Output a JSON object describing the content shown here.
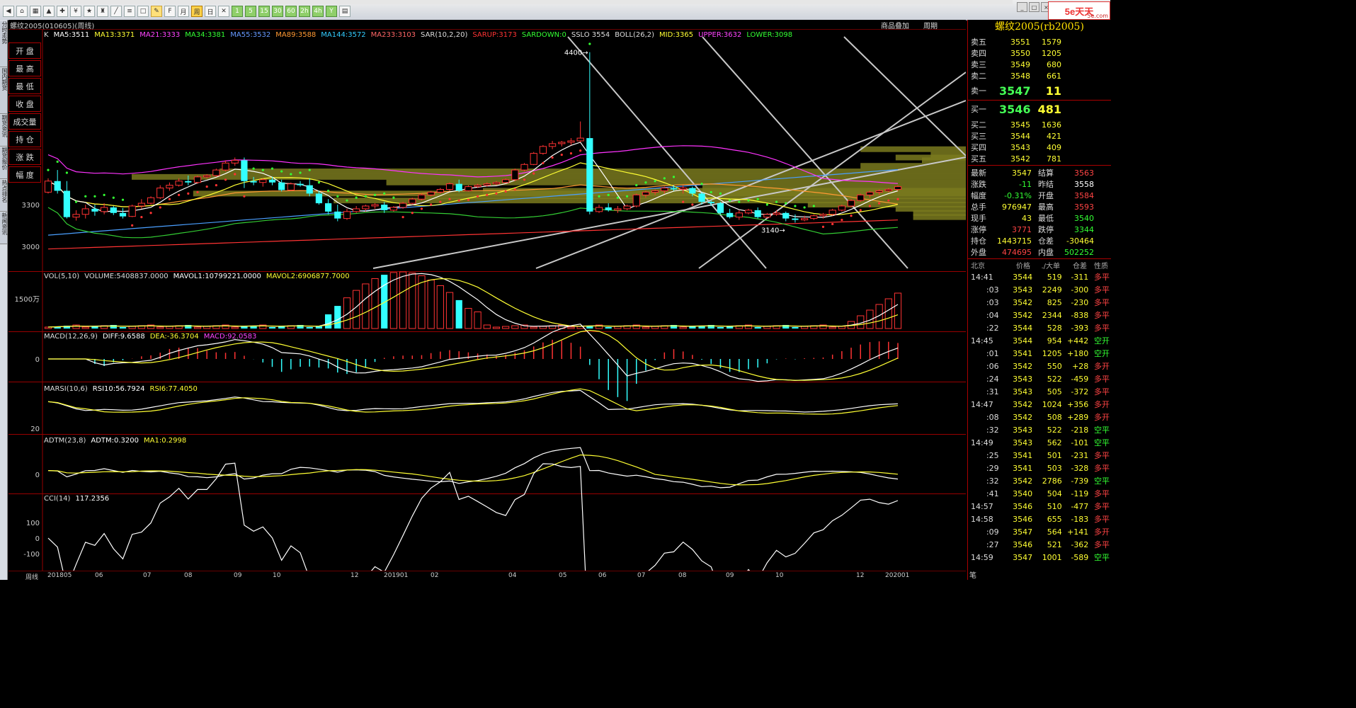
{
  "toolbar": {
    "buttons": [
      {
        "name": "back",
        "g": "◀"
      },
      {
        "name": "home",
        "g": "⌂"
      },
      {
        "name": "grid",
        "g": "▦"
      },
      {
        "name": "chart",
        "g": "▲"
      },
      {
        "name": "alert",
        "g": "✚"
      },
      {
        "name": "cash",
        "g": "¥"
      },
      {
        "name": "fav",
        "g": "★"
      },
      {
        "name": "cup",
        "g": "♜"
      },
      {
        "name": "line",
        "g": "╱"
      },
      {
        "name": "list",
        "g": "≡"
      },
      {
        "name": "box",
        "g": "□"
      },
      {
        "name": "sd",
        "g": "✎"
      },
      {
        "name": "f10",
        "g": "F"
      },
      {
        "name": "mo",
        "g": "月"
      },
      {
        "name": "wk",
        "g": "周"
      },
      {
        "name": "day",
        "g": "日"
      },
      {
        "name": "x",
        "g": "✕"
      },
      {
        "name": "m1",
        "g": "1"
      },
      {
        "name": "m5",
        "g": "5"
      },
      {
        "name": "m15",
        "g": "15"
      },
      {
        "name": "m30",
        "g": "30"
      },
      {
        "name": "m60",
        "g": "60"
      },
      {
        "name": "h2",
        "g": "2h"
      },
      {
        "name": "h4",
        "g": "4h"
      },
      {
        "name": "y",
        "g": "Y"
      },
      {
        "name": "calc",
        "g": "▤"
      }
    ]
  },
  "brand": {
    "mark": "5e天天",
    "sub": "5e.com"
  },
  "left_tabs": [
    "分时走势",
    "国内期货",
    "期货资讯",
    "期货报价",
    "热点排名",
    "新闻资讯"
  ],
  "attr_buttons": [
    "开 盘",
    "最 高",
    "最 低",
    "收 盘",
    "成交量",
    "持 仓",
    "涨 跌",
    "幅 度"
  ],
  "chart": {
    "title": "螺纹2005(010605)(周线)",
    "right_links": [
      "商品叠加",
      "周期"
    ],
    "indicator_line": [
      {
        "t": "K",
        "c": "#dddddd"
      },
      {
        "t": "MA5:3511",
        "c": "#ffffff"
      },
      {
        "t": "MA13:3371",
        "c": "#ffff33"
      },
      {
        "t": "MA21:3333",
        "c": "#ff44ff"
      },
      {
        "t": "MA34:3381",
        "c": "#33ff33"
      },
      {
        "t": "MA55:3532",
        "c": "#6699ff"
      },
      {
        "t": "MA89:3588",
        "c": "#ff9933"
      },
      {
        "t": "MA144:3572",
        "c": "#33ccff"
      },
      {
        "t": "MA233:3103",
        "c": "#ff6666"
      },
      {
        "t": "SAR(10,2,20)",
        "c": "#dddddd"
      },
      {
        "t": "SARUP:3173",
        "c": "#ff3333"
      },
      {
        "t": "SARDOWN:0",
        "c": "#33ff33"
      },
      {
        "t": "SSLO 3554",
        "c": "#dddddd"
      },
      {
        "t": "BOLL(26,2)",
        "c": "#dddddd"
      },
      {
        "t": "MID:3365",
        "c": "#ffff33"
      },
      {
        "t": "UPPER:3632",
        "c": "#ff44ff"
      },
      {
        "t": "LOWER:3098",
        "c": "#33ff33"
      }
    ],
    "y_labels": [
      "3300",
      "3000"
    ],
    "annot_high": "4400",
    "annot_low": "3140",
    "vol_line": [
      {
        "t": "VOL(5,10)",
        "c": "#dddddd"
      },
      {
        "t": "VOLUME:5408837.0000",
        "c": "#dddddd"
      },
      {
        "t": "MAVOL1:10799221.0000",
        "c": "#ffffff"
      },
      {
        "t": "MAVOL2:6906877.7000",
        "c": "#ffff33"
      }
    ],
    "vol_y": "1500万",
    "macd_line": [
      {
        "t": "MACD(12,26,9)",
        "c": "#dddddd"
      },
      {
        "t": "DIFF:9.6588",
        "c": "#ffffff"
      },
      {
        "t": "DEA:-36.3704",
        "c": "#ffff33"
      },
      {
        "t": "MACD:92.0583",
        "c": "#ff44ff"
      }
    ],
    "macd_y": "0",
    "rsi_line": [
      {
        "t": "MARSI(10,6)",
        "c": "#dddddd"
      },
      {
        "t": "RSI10:56.7924",
        "c": "#ffffff"
      },
      {
        "t": "RSI6:77.4050",
        "c": "#ffff33"
      }
    ],
    "rsi_y": "20",
    "adtm_line": [
      {
        "t": "ADTM(23,8)",
        "c": "#dddddd"
      },
      {
        "t": "ADTM:0.3200",
        "c": "#ffffff"
      },
      {
        "t": "MA1:0.2998",
        "c": "#ffff33"
      }
    ],
    "adtm_y": "0",
    "cci_line": [
      {
        "t": "CCI(14)",
        "c": "#dddddd"
      },
      {
        "t": "117.2356",
        "c": "#ffffff"
      }
    ],
    "cci_y": [
      "100",
      "0",
      "-100"
    ],
    "period_label": "周线",
    "date_labels": [
      "201805",
      "06",
      "07",
      "08",
      "09",
      "10",
      "12",
      "201901",
      "02",
      "04",
      "05",
      "06",
      "07",
      "08",
      "09",
      "10",
      "12",
      "202001"
    ]
  },
  "quote": {
    "title": "螺纹2005(rb2005)",
    "asks": [
      {
        "l": "卖五",
        "p": "3551",
        "v": "1579"
      },
      {
        "l": "卖四",
        "p": "3550",
        "v": "1205"
      },
      {
        "l": "卖三",
        "p": "3549",
        "v": "680"
      },
      {
        "l": "卖二",
        "p": "3548",
        "v": "661"
      }
    ],
    "ask1": {
      "l": "卖一",
      "p": "3547",
      "v": "11"
    },
    "bid1": {
      "l": "买一",
      "p": "3546",
      "v": "481"
    },
    "bids": [
      {
        "l": "买二",
        "p": "3545",
        "v": "1636"
      },
      {
        "l": "买三",
        "p": "3544",
        "v": "421"
      },
      {
        "l": "买四",
        "p": "3543",
        "v": "409"
      },
      {
        "l": "买五",
        "p": "3542",
        "v": "781"
      }
    ],
    "stats": [
      {
        "a": "最新",
        "av": "3547",
        "ac": "#ffff33",
        "b": "结算",
        "bv": "3563",
        "bc": "#ff4444"
      },
      {
        "a": "涨跌",
        "av": "-11",
        "ac": "#33ff33",
        "b": "昨结",
        "bv": "3558",
        "bc": "#ffffff"
      },
      {
        "a": "幅度",
        "av": "-0.31%",
        "ac": "#33ff33",
        "b": "开盘",
        "bv": "3584",
        "bc": "#ff4444"
      },
      {
        "a": "总手",
        "av": "976947",
        "ac": "#ffff33",
        "b": "最高",
        "bv": "3593",
        "bc": "#ff4444"
      },
      {
        "a": "现手",
        "av": "43",
        "ac": "#ffff33",
        "b": "最低",
        "bv": "3540",
        "bc": "#33ff33"
      },
      {
        "a": "涨停",
        "av": "3771",
        "ac": "#ff4444",
        "b": "跌停",
        "bv": "3344",
        "bc": "#33ff33"
      },
      {
        "a": "持仓",
        "av": "1443715",
        "ac": "#ffff33",
        "b": "仓差",
        "bv": "-30464",
        "bc": "#ffff33"
      },
      {
        "a": "外盘",
        "av": "474695",
        "ac": "#ff4444",
        "b": "内盘",
        "bv": "502252",
        "bc": "#33ff33"
      }
    ],
    "ticks_header": [
      "北京",
      "价格",
      "./大单",
      "仓差",
      "性质"
    ],
    "ticks": [
      {
        "t": "14:41",
        "p": "3544",
        "pc": "#ffff33",
        "v": "519",
        "d": "-311",
        "n": "多平",
        "nc": "#ff4444",
        "main": true
      },
      {
        "t": ":03",
        "p": "3543",
        "pc": "#ffff33",
        "v": "2249",
        "d": "-300",
        "n": "多平",
        "nc": "#ff4444",
        "main": false
      },
      {
        "t": ":03",
        "p": "3542",
        "pc": "#ffff33",
        "v": "825",
        "d": "-230",
        "n": "多平",
        "nc": "#ff4444",
        "main": false
      },
      {
        "t": ":04",
        "p": "3542",
        "pc": "#ffff33",
        "v": "2344",
        "d": "-838",
        "n": "多平",
        "nc": "#ff4444",
        "main": false
      },
      {
        "t": ":22",
        "p": "3544",
        "pc": "#ffff33",
        "v": "528",
        "d": "-393",
        "n": "多平",
        "nc": "#ff4444",
        "main": false
      },
      {
        "t": "14:45",
        "p": "3544",
        "pc": "#ffff33",
        "v": "954",
        "d": "+442",
        "n": "空开",
        "nc": "#33ff33",
        "main": true
      },
      {
        "t": ":01",
        "p": "3541",
        "pc": "#ffff33",
        "v": "1205",
        "d": "+180",
        "n": "空开",
        "nc": "#33ff33",
        "main": false
      },
      {
        "t": ":06",
        "p": "3542",
        "pc": "#ffff33",
        "v": "550",
        "d": "+28",
        "n": "多开",
        "nc": "#ff4444",
        "main": false
      },
      {
        "t": ":24",
        "p": "3543",
        "pc": "#ffff33",
        "v": "522",
        "d": "-459",
        "n": "多平",
        "nc": "#ff4444",
        "main": false
      },
      {
        "t": ":31",
        "p": "3543",
        "pc": "#ffff33",
        "v": "505",
        "d": "-372",
        "n": "多平",
        "nc": "#ff4444",
        "main": false
      },
      {
        "t": "14:47",
        "p": "3542",
        "pc": "#ffff33",
        "v": "1024",
        "d": "+356",
        "n": "多开",
        "nc": "#ff4444",
        "main": true
      },
      {
        "t": ":08",
        "p": "3542",
        "pc": "#ffff33",
        "v": "508",
        "d": "+289",
        "n": "多开",
        "nc": "#ff4444",
        "main": false
      },
      {
        "t": ":32",
        "p": "3543",
        "pc": "#ffff33",
        "v": "522",
        "d": "-218",
        "n": "空平",
        "nc": "#33ff33",
        "main": false
      },
      {
        "t": "14:49",
        "p": "3543",
        "pc": "#ffff33",
        "v": "562",
        "d": "-101",
        "n": "空平",
        "nc": "#33ff33",
        "main": true
      },
      {
        "t": ":25",
        "p": "3541",
        "pc": "#ffff33",
        "v": "501",
        "d": "-231",
        "n": "多平",
        "nc": "#ff4444",
        "main": false
      },
      {
        "t": ":29",
        "p": "3541",
        "pc": "#ffff33",
        "v": "503",
        "d": "-328",
        "n": "多平",
        "nc": "#ff4444",
        "main": false
      },
      {
        "t": ":32",
        "p": "3542",
        "pc": "#ffff33",
        "v": "2786",
        "d": "-739",
        "n": "空平",
        "nc": "#33ff33",
        "main": false
      },
      {
        "t": ":41",
        "p": "3540",
        "pc": "#ffff33",
        "v": "504",
        "d": "-119",
        "n": "多平",
        "nc": "#ff4444",
        "main": false
      },
      {
        "t": "14:57",
        "p": "3546",
        "pc": "#ffff33",
        "v": "510",
        "d": "-477",
        "n": "多平",
        "nc": "#ff4444",
        "main": true
      },
      {
        "t": "14:58",
        "p": "3546",
        "pc": "#ffff33",
        "v": "655",
        "d": "-183",
        "n": "多平",
        "nc": "#ff4444",
        "main": true
      },
      {
        "t": ":09",
        "p": "3547",
        "pc": "#ffff33",
        "v": "564",
        "d": "+141",
        "n": "多开",
        "nc": "#ff4444",
        "main": false
      },
      {
        "t": ":27",
        "p": "3546",
        "pc": "#ffff33",
        "v": "521",
        "d": "-362",
        "n": "多平",
        "nc": "#ff4444",
        "main": false
      },
      {
        "t": "14:59",
        "p": "3547",
        "pc": "#ffff33",
        "v": "1001",
        "d": "-589",
        "n": "空平",
        "nc": "#33ff33",
        "main": true
      }
    ],
    "bottom_tab": "笔"
  },
  "candles": [
    [
      3390,
      3490,
      3380,
      3470
    ],
    [
      3470,
      3550,
      3380,
      3400
    ],
    [
      3400,
      3470,
      3200,
      3210
    ],
    [
      3210,
      3260,
      3185,
      3230
    ],
    [
      3230,
      3300,
      3200,
      3270
    ],
    [
      3270,
      3300,
      3220,
      3250
    ],
    [
      3250,
      3310,
      3230,
      3280
    ],
    [
      3280,
      3290,
      3225,
      3240
    ],
    [
      3240,
      3275,
      3200,
      3215
    ],
    [
      3215,
      3300,
      3210,
      3290
    ],
    [
      3290,
      3340,
      3270,
      3310
    ],
    [
      3310,
      3360,
      3300,
      3350
    ],
    [
      3350,
      3440,
      3340,
      3420
    ],
    [
      3420,
      3460,
      3400,
      3440
    ],
    [
      3440,
      3490,
      3430,
      3470
    ],
    [
      3470,
      3510,
      3440,
      3460
    ],
    [
      3460,
      3510,
      3450,
      3500
    ],
    [
      3500,
      3520,
      3490,
      3510
    ],
    [
      3510,
      3560,
      3500,
      3550
    ],
    [
      3550,
      3620,
      3540,
      3600
    ],
    [
      3600,
      3640,
      3580,
      3620
    ],
    [
      3620,
      3640,
      3420,
      3470
    ],
    [
      3470,
      3500,
      3440,
      3460
    ],
    [
      3460,
      3490,
      3430,
      3480
    ],
    [
      3480,
      3500,
      3440,
      3460
    ],
    [
      3460,
      3480,
      3395,
      3405
    ],
    [
      3405,
      3460,
      3400,
      3450
    ],
    [
      3450,
      3470,
      3430,
      3440
    ],
    [
      3440,
      3490,
      3360,
      3380
    ],
    [
      3380,
      3400,
      3300,
      3310
    ],
    [
      3310,
      3340,
      3230,
      3250
    ],
    [
      3250,
      3300,
      3180,
      3200
    ],
    [
      3200,
      3270,
      3190,
      3250
    ],
    [
      3250,
      3290,
      3240,
      3270
    ],
    [
      3270,
      3300,
      3250,
      3290
    ],
    [
      3290,
      3310,
      3270,
      3300
    ],
    [
      3300,
      3320,
      3240,
      3260
    ],
    [
      3260,
      3290,
      3250,
      3280
    ],
    [
      3280,
      3320,
      3270,
      3310
    ],
    [
      3310,
      3350,
      3300,
      3340
    ],
    [
      3340,
      3380,
      3330,
      3370
    ],
    [
      3370,
      3400,
      3360,
      3390
    ],
    [
      3390,
      3420,
      3380,
      3410
    ],
    [
      3410,
      3460,
      3400,
      3450
    ],
    [
      3450,
      3480,
      3390,
      3400
    ],
    [
      3400,
      3440,
      3395,
      3430
    ],
    [
      3430,
      3450,
      3420,
      3440
    ],
    [
      3440,
      3460,
      3430,
      3450
    ],
    [
      3450,
      3470,
      3440,
      3460
    ],
    [
      3460,
      3490,
      3455,
      3480
    ],
    [
      3480,
      3560,
      3470,
      3550
    ],
    [
      3550,
      3600,
      3540,
      3590
    ],
    [
      3590,
      3680,
      3585,
      3670
    ],
    [
      3670,
      3730,
      3660,
      3720
    ],
    [
      3720,
      3760,
      3700,
      3740
    ],
    [
      3740,
      3760,
      3720,
      3750
    ],
    [
      3750,
      3780,
      3730,
      3760
    ],
    [
      3760,
      3900,
      3750,
      3780
    ],
    [
      3780,
      4400,
      3230,
      3250
    ],
    [
      3250,
      3300,
      3240,
      3280
    ],
    [
      3280,
      3310,
      3250,
      3260
    ],
    [
      3260,
      3290,
      3240,
      3270
    ],
    [
      3270,
      3300,
      3260,
      3290
    ],
    [
      3290,
      3380,
      3280,
      3370
    ],
    [
      3370,
      3400,
      3350,
      3390
    ],
    [
      3390,
      3410,
      3370,
      3400
    ],
    [
      3400,
      3430,
      3380,
      3420
    ],
    [
      3420,
      3440,
      3400,
      3410
    ],
    [
      3410,
      3440,
      3380,
      3420
    ],
    [
      3420,
      3430,
      3360,
      3380
    ],
    [
      3380,
      3390,
      3300,
      3320
    ],
    [
      3320,
      3330,
      3290,
      3310
    ],
    [
      3310,
      3320,
      3230,
      3240
    ],
    [
      3240,
      3270,
      3200,
      3210
    ],
    [
      3210,
      3260,
      3190,
      3240
    ],
    [
      3240,
      3270,
      3230,
      3260
    ],
    [
      3260,
      3280,
      3200,
      3210
    ],
    [
      3210,
      3240,
      3200,
      3230
    ],
    [
      3230,
      3260,
      3220,
      3240
    ],
    [
      3240,
      3250,
      3180,
      3200
    ],
    [
      3200,
      3230,
      3170,
      3190
    ],
    [
      3190,
      3220,
      3180,
      3200
    ],
    [
      3200,
      3230,
      3190,
      3220
    ],
    [
      3220,
      3240,
      3200,
      3230
    ],
    [
      3230,
      3270,
      3220,
      3260
    ],
    [
      3260,
      3300,
      3250,
      3290
    ],
    [
      3290,
      3340,
      3280,
      3330
    ],
    [
      3330,
      3380,
      3320,
      3370
    ],
    [
      3370,
      3400,
      3350,
      3390
    ],
    [
      3390,
      3410,
      3370,
      3400
    ],
    [
      3400,
      3420,
      3390,
      3410
    ],
    [
      3410,
      3440,
      3400,
      3430
    ]
  ]
}
